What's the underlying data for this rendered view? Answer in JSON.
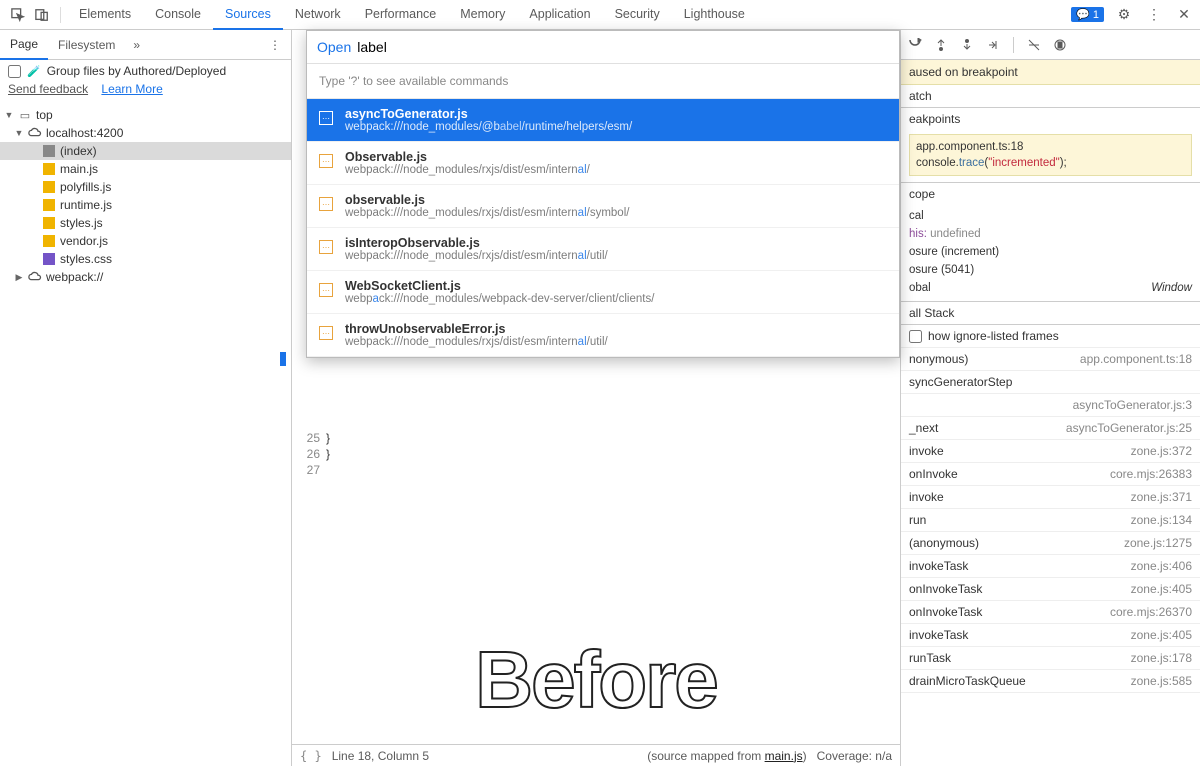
{
  "topTabs": {
    "items": [
      "Elements",
      "Console",
      "Sources",
      "Network",
      "Performance",
      "Memory",
      "Application",
      "Security",
      "Lighthouse"
    ],
    "active": "Sources",
    "badgeCount": "1"
  },
  "leftTabs": {
    "page": "Page",
    "filesystem": "Filesystem",
    "more": "»"
  },
  "group": {
    "label": "Group files by Authored/Deployed",
    "feedback": "Send feedback",
    "learnMore": "Learn More"
  },
  "tree": {
    "top": "top",
    "host": "localhost:4200",
    "files": [
      "(index)",
      "main.js",
      "polyfills.js",
      "runtime.js",
      "styles.js",
      "vendor.js",
      "styles.css"
    ],
    "webpack": "webpack://"
  },
  "popup": {
    "cmd": "Open",
    "query": "label",
    "hint": "Type '?' to see available commands",
    "items": [
      {
        "title": "asyncToGenerator.js",
        "path": "webpack:///node_modules/@babel/runtime/helpers/esm/",
        "hi": "abel"
      },
      {
        "title": "Observable.js",
        "path": "webpack:///node_modules/rxjs/dist/esm/internal/",
        "hi": "al"
      },
      {
        "title": "observable.js",
        "path": "webpack:///node_modules/rxjs/dist/esm/internal/symbol/",
        "hi": "al"
      },
      {
        "title": "isInteropObservable.js",
        "path": "webpack:///node_modules/rxjs/dist/esm/internal/util/",
        "hi": "al"
      },
      {
        "title": "WebSocketClient.js",
        "path": "webpack:///node_modules/webpack-dev-server/client/clients/",
        "hi": "a"
      },
      {
        "title": "throwUnobservableError.js",
        "path": "webpack:///node_modules/rxjs/dist/esm/internal/util/",
        "hi": "al"
      }
    ]
  },
  "editor": {
    "lines": [
      "25",
      "26",
      "27"
    ],
    "code": [
      "  }",
      "}",
      ""
    ]
  },
  "status": {
    "pos": "Line 18, Column 5",
    "mapped": "(source mapped from ",
    "mappedFile": "main.js",
    "mappedEnd": ")",
    "coverage": "Coverage: n/a"
  },
  "watermark": "Before",
  "debug": {
    "paused": "aused on breakpoint",
    "watch": "atch",
    "breakpoints": "eakpoints",
    "bpFile": "app.component.ts:18",
    "bpCode1": "console.",
    "bpCode2": "trace",
    "bpCode3": "(",
    "bpCode4": "\"incremented\"",
    "bpCode5": ");",
    "scope": "cope",
    "scopeRows": [
      {
        "l": "cal",
        "r": ""
      },
      {
        "l": "his: ",
        "r": "",
        "v": "undefined"
      },
      {
        "l": "osure (increment)",
        "r": ""
      },
      {
        "l": "osure (5041)",
        "r": ""
      },
      {
        "l": "obal",
        "r": "Window"
      }
    ],
    "callstack": "all Stack",
    "showIgnore": "how ignore-listed frames",
    "frames": [
      {
        "fn": "nonymous)",
        "loc": "app.component.ts:18"
      },
      {
        "fn": "syncGeneratorStep",
        "loc": ""
      },
      {
        "fn": "",
        "loc": "asyncToGenerator.js:3"
      },
      {
        "fn": "_next",
        "loc": "asyncToGenerator.js:25"
      },
      {
        "fn": "invoke",
        "loc": "zone.js:372"
      },
      {
        "fn": "onInvoke",
        "loc": "core.mjs:26383"
      },
      {
        "fn": "invoke",
        "loc": "zone.js:371"
      },
      {
        "fn": "run",
        "loc": "zone.js:134"
      },
      {
        "fn": "(anonymous)",
        "loc": "zone.js:1275"
      },
      {
        "fn": "invokeTask",
        "loc": "zone.js:406"
      },
      {
        "fn": "onInvokeTask",
        "loc": "zone.js:405"
      },
      {
        "fn": "onInvokeTask",
        "loc": "core.mjs:26370"
      },
      {
        "fn": "invokeTask",
        "loc": "zone.js:405"
      },
      {
        "fn": "runTask",
        "loc": "zone.js:178"
      },
      {
        "fn": "drainMicroTaskQueue",
        "loc": "zone.js:585"
      }
    ]
  }
}
